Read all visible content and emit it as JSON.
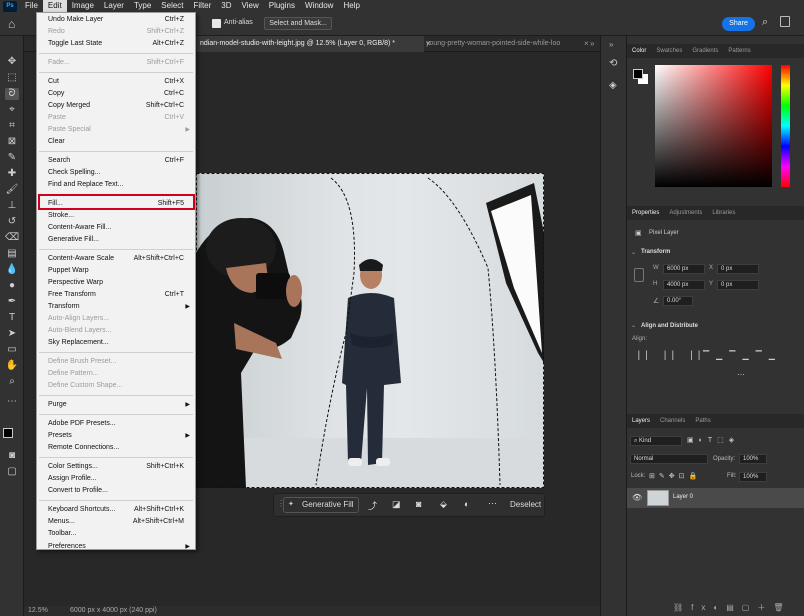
{
  "menubar": {
    "items": [
      "File",
      "Edit",
      "Image",
      "Layer",
      "Type",
      "Select",
      "Filter",
      "3D",
      "View",
      "Plugins",
      "Window",
      "Help"
    ],
    "logo": "Ps"
  },
  "options": {
    "anti_alias": "Anti-alias",
    "select_mask": "Select and Mask...",
    "share": "Share"
  },
  "tabs": [
    {
      "label": "ndian-model-studio-with-leight.jpg @ 12.5% (Layer 0, RGB/8) *",
      "active": true
    },
    {
      "label": "young-pretty-woman-pointed-side-while-loo",
      "active": false
    }
  ],
  "edit_menu": {
    "items": [
      {
        "label": "Undo Make Layer",
        "shortcut": "Ctrl+Z",
        "disabled": false
      },
      {
        "label": "Redo",
        "shortcut": "Shift+Ctrl+Z",
        "disabled": true
      },
      {
        "label": "Toggle Last State",
        "shortcut": "Alt+Ctrl+Z",
        "disabled": false
      },
      {
        "label": "Fade...",
        "shortcut": "Shift+Ctrl+F",
        "disabled": true
      },
      {
        "label": "Cut",
        "shortcut": "Ctrl+X",
        "disabled": false
      },
      {
        "label": "Copy",
        "shortcut": "Ctrl+C",
        "disabled": false
      },
      {
        "label": "Copy Merged",
        "shortcut": "Shift+Ctrl+C",
        "disabled": false
      },
      {
        "label": "Paste",
        "shortcut": "Ctrl+V",
        "disabled": true
      },
      {
        "label": "Paste Special",
        "shortcut": "",
        "disabled": true,
        "submenu": true
      },
      {
        "label": "Clear",
        "shortcut": "",
        "disabled": false
      },
      {
        "label": "Search",
        "shortcut": "Ctrl+F",
        "disabled": false
      },
      {
        "label": "Check Spelling...",
        "shortcut": "",
        "disabled": false
      },
      {
        "label": "Find and Replace Text...",
        "shortcut": "",
        "disabled": false
      },
      {
        "label": "Fill...",
        "shortcut": "Shift+F5",
        "disabled": false,
        "highlighted": true
      },
      {
        "label": "Stroke...",
        "shortcut": "",
        "disabled": false
      },
      {
        "label": "Content-Aware Fill...",
        "shortcut": "",
        "disabled": false
      },
      {
        "label": "Generative Fill...",
        "shortcut": "",
        "disabled": false
      },
      {
        "label": "Content-Aware Scale",
        "shortcut": "Alt+Shift+Ctrl+C",
        "disabled": false
      },
      {
        "label": "Puppet Warp",
        "shortcut": "",
        "disabled": false
      },
      {
        "label": "Perspective Warp",
        "shortcut": "",
        "disabled": false
      },
      {
        "label": "Free Transform",
        "shortcut": "Ctrl+T",
        "disabled": false
      },
      {
        "label": "Transform",
        "shortcut": "",
        "disabled": false,
        "submenu": true
      },
      {
        "label": "Auto-Align Layers...",
        "shortcut": "",
        "disabled": true
      },
      {
        "label": "Auto-Blend Layers...",
        "shortcut": "",
        "disabled": true
      },
      {
        "label": "Sky Replacement...",
        "shortcut": "",
        "disabled": false
      },
      {
        "label": "Define Brush Preset...",
        "shortcut": "",
        "disabled": true
      },
      {
        "label": "Define Pattern...",
        "shortcut": "",
        "disabled": true
      },
      {
        "label": "Define Custom Shape...",
        "shortcut": "",
        "disabled": true
      },
      {
        "label": "Purge",
        "shortcut": "",
        "disabled": false,
        "submenu": true
      },
      {
        "label": "Adobe PDF Presets...",
        "shortcut": "",
        "disabled": false
      },
      {
        "label": "Presets",
        "shortcut": "",
        "disabled": false,
        "submenu": true
      },
      {
        "label": "Remote Connections...",
        "shortcut": "",
        "disabled": false
      },
      {
        "label": "Color Settings...",
        "shortcut": "Shift+Ctrl+K",
        "disabled": false
      },
      {
        "label": "Assign Profile...",
        "shortcut": "",
        "disabled": false
      },
      {
        "label": "Convert to Profile...",
        "shortcut": "",
        "disabled": false
      },
      {
        "label": "Keyboard Shortcuts...",
        "shortcut": "Alt+Shift+Ctrl+K",
        "disabled": false
      },
      {
        "label": "Menus...",
        "shortcut": "Alt+Shift+Ctrl+M",
        "disabled": false
      },
      {
        "label": "Toolbar...",
        "shortcut": "",
        "disabled": false
      },
      {
        "label": "Preferences",
        "shortcut": "",
        "disabled": false,
        "submenu": true
      }
    ]
  },
  "context_bar": {
    "generative_fill": "Generative Fill",
    "deselect": "Deselect"
  },
  "status": {
    "zoom": "12.5%",
    "doc_size": "6000 px x 4000 px (240 ppi)"
  },
  "color_panel": {
    "tabs": [
      "Color",
      "Swatches",
      "Gradients",
      "Patterns"
    ]
  },
  "properties_panel": {
    "tabs": [
      "Properties",
      "Adjustments",
      "Libraries"
    ],
    "layer_kind": "Pixel Layer",
    "transform_label": "Transform",
    "w_label": "W",
    "w": "6000 px",
    "h_label": "H",
    "h": "4000 px",
    "x_label": "X",
    "x": "0 px",
    "y_label": "Y",
    "y": "0 px",
    "angle": "0.00°",
    "align_label": "Align and Distribute",
    "align_sub": "Align:"
  },
  "layers_panel": {
    "tabs": [
      "Layers",
      "Channels",
      "Paths"
    ],
    "kind": "Kind",
    "blend": "Normal",
    "opacity_label": "Opacity:",
    "opacity": "100%",
    "lock_label": "Lock:",
    "fill_label": "Fill:",
    "fill": "100%",
    "layer_name": "Layer 0"
  },
  "colors": {
    "menu_bg": "#f2f2f2",
    "highlight_border": "#d0021b",
    "share_blue": "#1473e6",
    "panel_bg": "#323232"
  }
}
